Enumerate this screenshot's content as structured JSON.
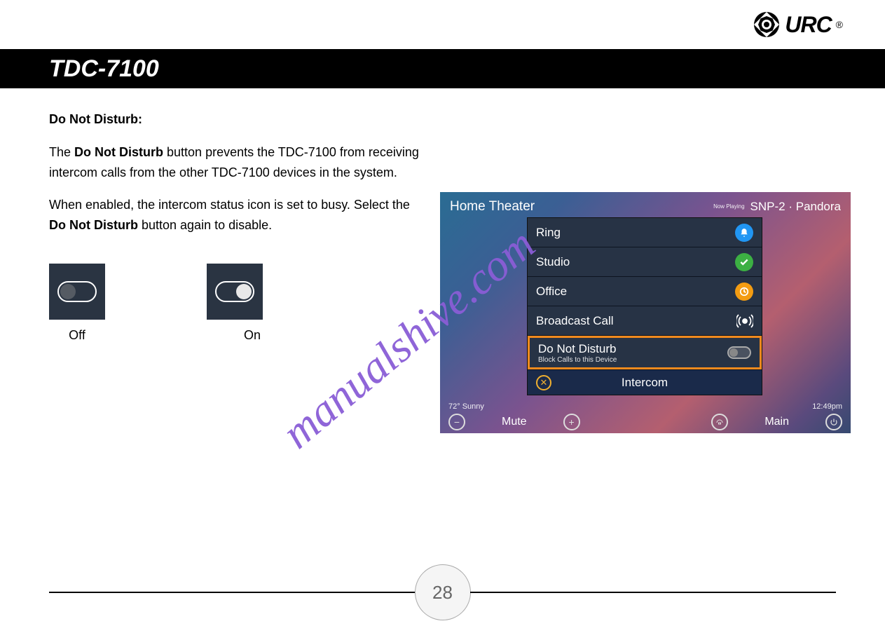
{
  "brand": {
    "logo_text": "URC",
    "trademark": "®"
  },
  "header": {
    "bar_title": "TDC-7100"
  },
  "body": {
    "heading": "Do Not Disturb:",
    "p1a": "The ",
    "p1b": "Do Not Disturb",
    "p1c": " button prevents the TDC-7100 from receiving intercom calls from the other TDC-7100 devices in the system.",
    "p2a": "When enabled, the intercom status icon is set to busy. Select the ",
    "p2b": "Do Not Disturb",
    "p2c": " button again to disable.",
    "toggle_off_label": "Off",
    "toggle_on_label": "On"
  },
  "screenshot": {
    "room": "Home Theater",
    "now_playing_tag": "Now Playing",
    "now_playing_text": "SNP-2 · Pandora",
    "menu": {
      "items": [
        {
          "label": "Ring",
          "icon": "bell"
        },
        {
          "label": "Studio",
          "icon": "check"
        },
        {
          "label": "Office",
          "icon": "clock"
        },
        {
          "label": "Broadcast Call",
          "icon": "broadcast"
        }
      ],
      "dnd": {
        "label": "Do Not Disturb",
        "sub": "Block Calls to this Device"
      },
      "footer_title": "Intercom"
    },
    "status": {
      "left": "72° Sunny",
      "right": "12:49pm"
    },
    "bottombar": {
      "mute": "Mute",
      "main": "Main"
    }
  },
  "watermark": "manualshive.com",
  "page_number": "28"
}
